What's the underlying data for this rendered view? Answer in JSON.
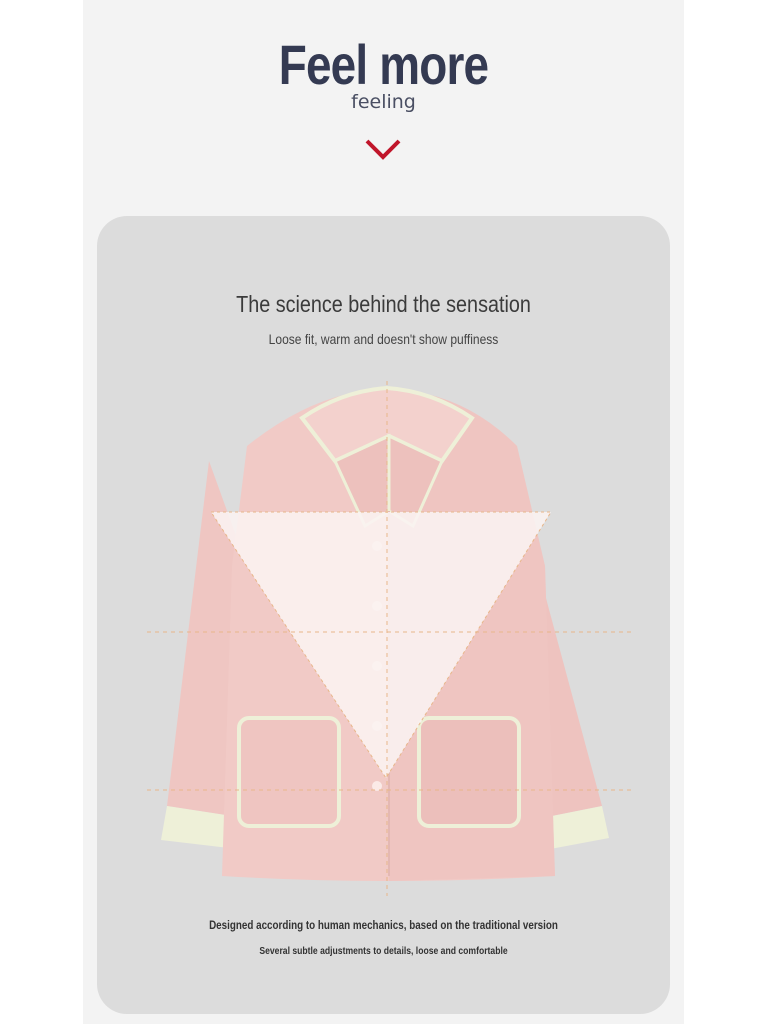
{
  "hero": {
    "title": "Feel more",
    "subtitle": "feeling",
    "chevron_icon": "chevron-down-icon",
    "accent_color": "#c0152a"
  },
  "card": {
    "title": "The science behind the sensation",
    "subtitle": "Loose fit, warm and doesn't show puffiness",
    "product_image": "pink pajama jacket illustration",
    "caption_line1": "Designed according to human mechanics, based on the traditional version",
    "caption_line2": "Several subtle adjustments to details, loose and comfortable",
    "colors": {
      "background": "#dcdcdc",
      "garment": "#f0c9c5",
      "trim": "#eef0d8",
      "guide_line": "#e8b68a"
    }
  }
}
